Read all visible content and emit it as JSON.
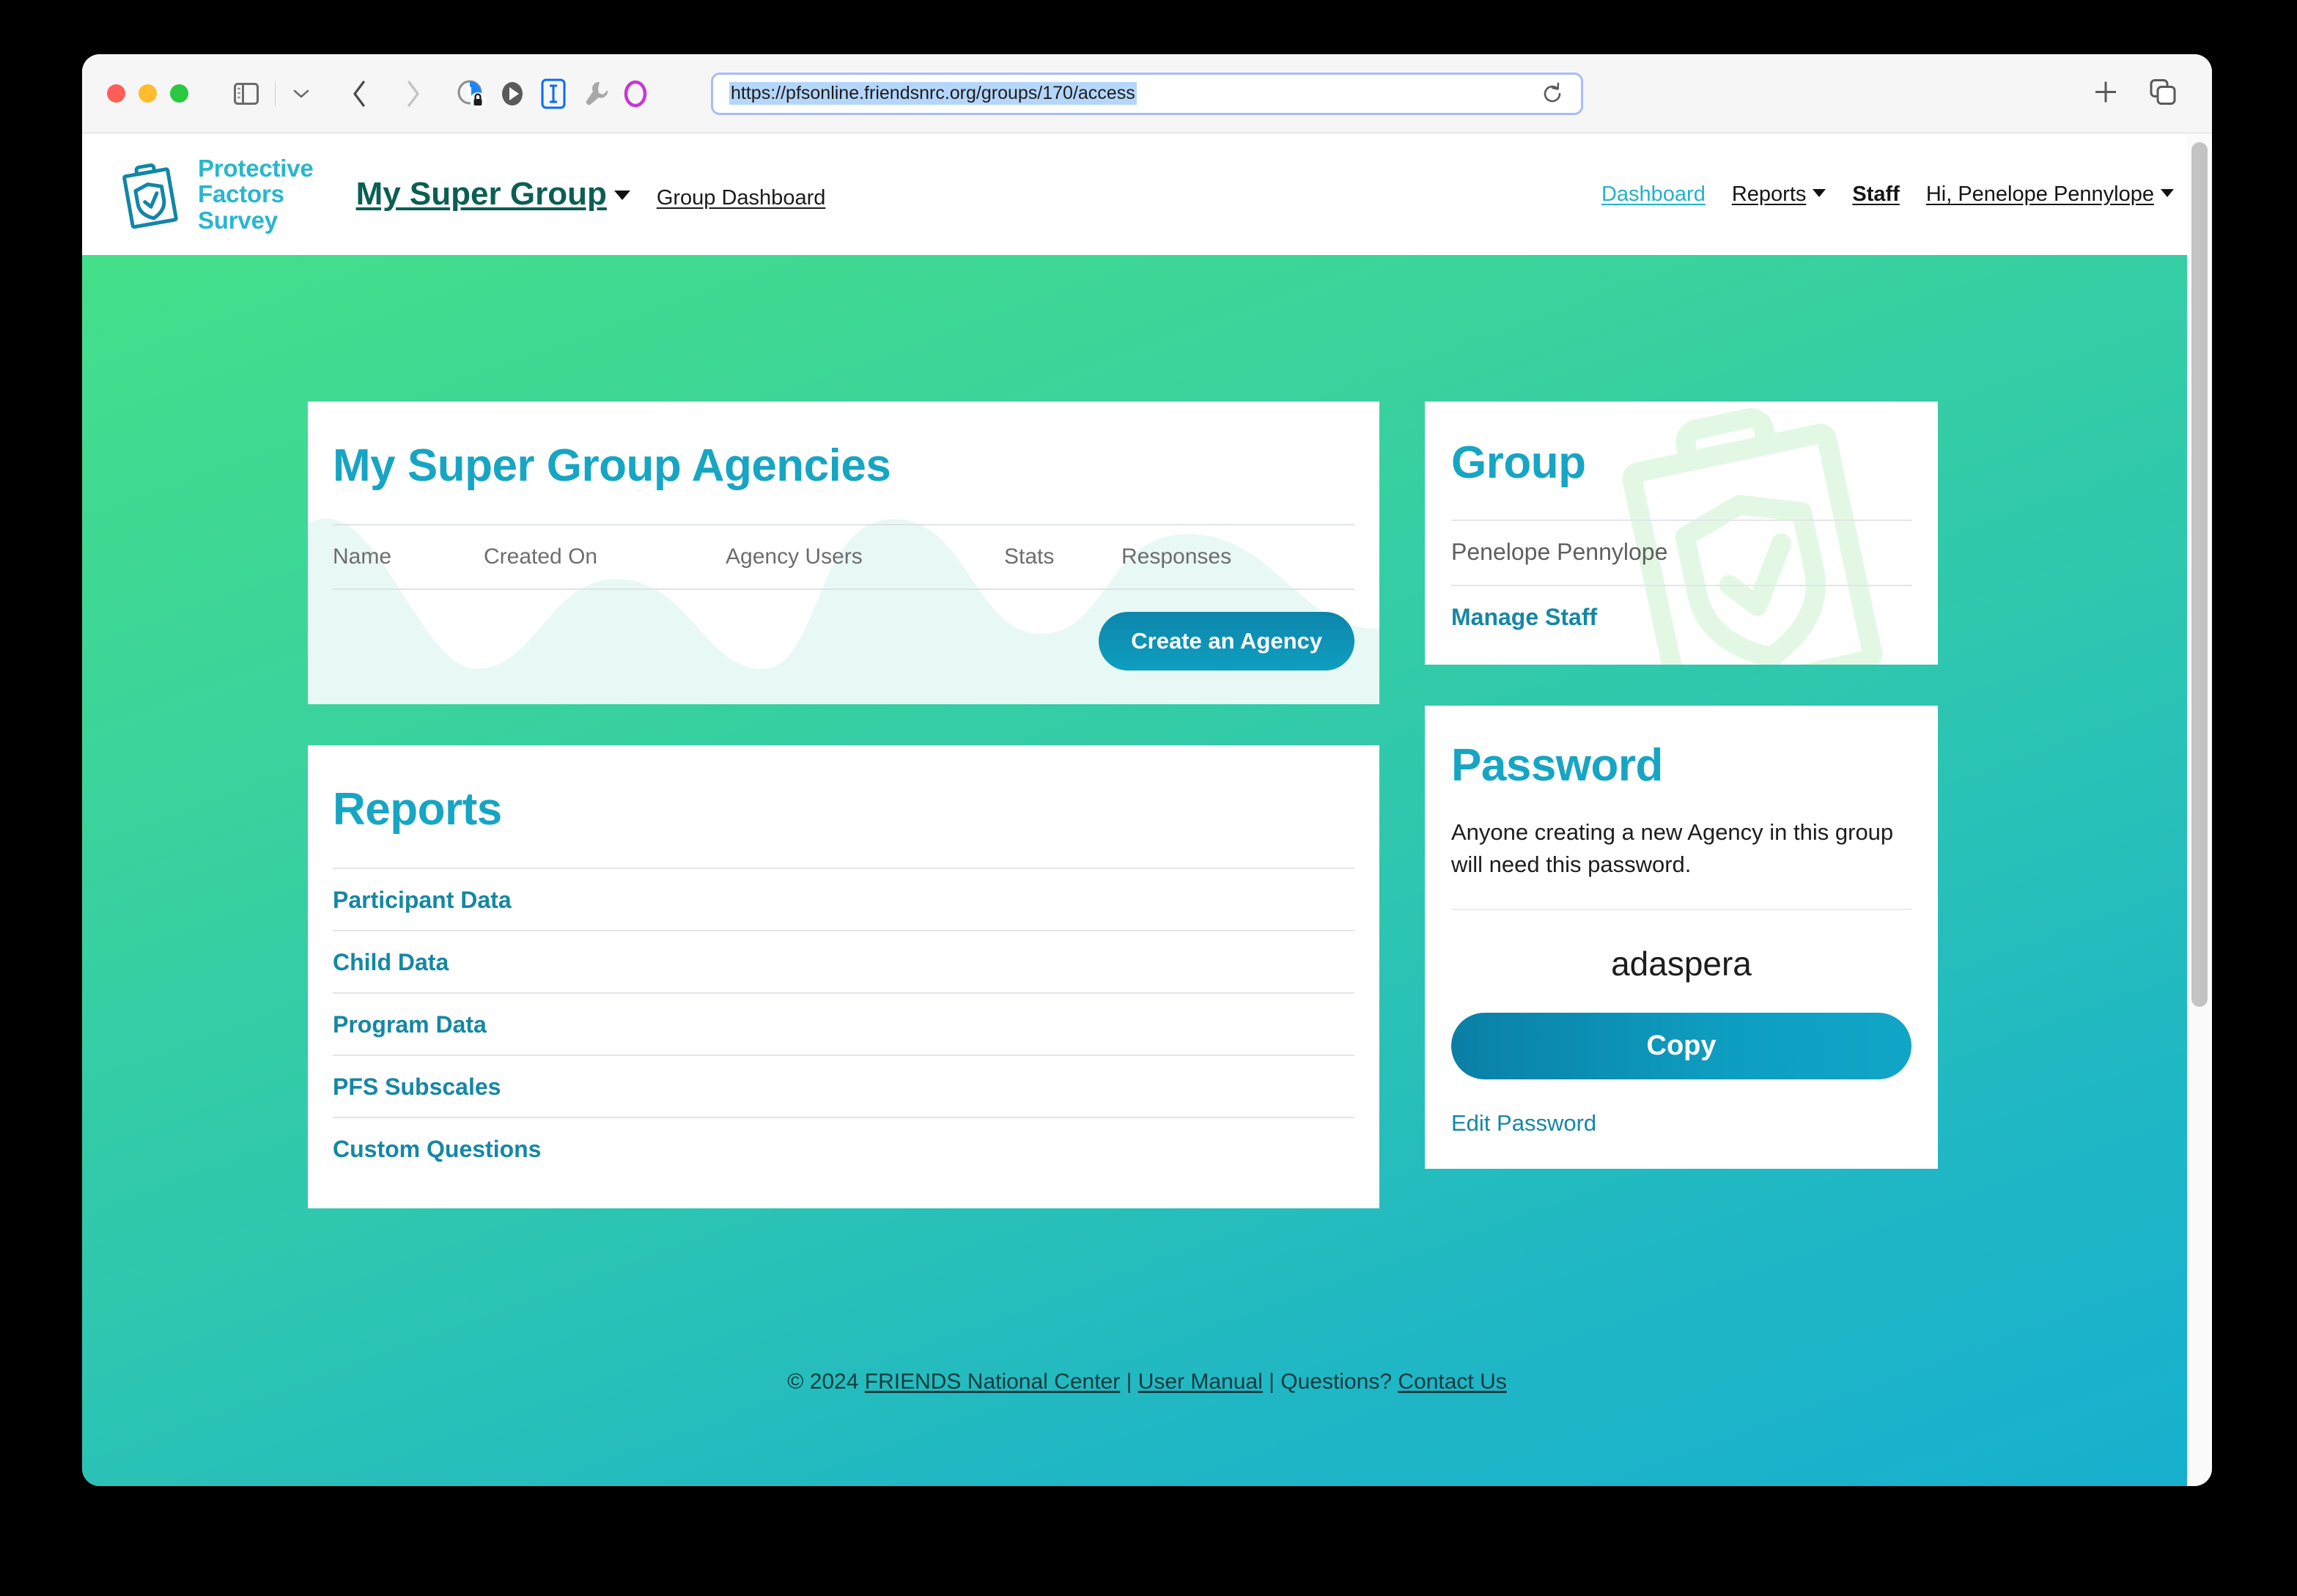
{
  "browser": {
    "url": "https://pfsonline.friendsnrc.org/groups/170/access",
    "url_selected": true,
    "toolbar_icons": [
      "sidebar-toggle-icon",
      "chevron-down-icon",
      "back-arrow-icon",
      "forward-arrow-icon",
      "privacy-lock-icon",
      "play-icon",
      "reader-mode-icon",
      "wrench-icon",
      "ring-icon"
    ],
    "right_icons": [
      "new-tab-plus-icon",
      "tab-overview-icon"
    ],
    "reload_icon": "reload-icon"
  },
  "header": {
    "brand": {
      "logo_icon": "clipboard-shield-check-icon",
      "line1": "Protective",
      "line2": "Factors",
      "line3": "Survey"
    },
    "group_name": "My Super Group",
    "group_dashboard_label": "Group Dashboard",
    "nav": [
      {
        "label": "Dashboard",
        "active": true,
        "has_caret": false,
        "bold": false
      },
      {
        "label": "Reports",
        "active": false,
        "has_caret": true,
        "bold": false
      },
      {
        "label": "Staff",
        "active": false,
        "has_caret": false,
        "bold": true
      },
      {
        "label": "Hi, Penelope Pennylope",
        "active": false,
        "has_caret": true,
        "bold": false
      }
    ]
  },
  "agencies_card": {
    "title": "My Super Group Agencies",
    "columns": [
      "Name",
      "Created On",
      "Agency Users",
      "Stats",
      "Responses"
    ],
    "rows": [],
    "create_button_label": "Create an Agency"
  },
  "reports_card": {
    "title": "Reports",
    "items": [
      "Participant Data",
      "Child Data",
      "Program Data",
      "PFS Subscales",
      "Custom Questions"
    ]
  },
  "group_card": {
    "title": "Group",
    "owner": "Penelope Pennylope",
    "manage_staff_label": "Manage Staff"
  },
  "password_card": {
    "title": "Password",
    "description": "Anyone creating a new Agency in this group will need this password.",
    "value": "adaspera",
    "copy_label": "Copy",
    "edit_label": "Edit Password"
  },
  "footer": {
    "copyright": "© 2024 ",
    "org_link": "FRIENDS National Center",
    "sep1": " | ",
    "manual_link": "User Manual",
    "sep2": " | Questions? ",
    "contact_link": "Contact Us"
  },
  "colors": {
    "brand_teal": "#29b6ce",
    "card_title": "#17a5c4",
    "group_name": "#0b5f52",
    "link_teal": "#1587a4",
    "nav_active": "#22b2c9",
    "button_gradient_start": "#0a7fa6",
    "button_gradient_end": "#10a5c6",
    "bg_gradient_start": "#44df8a",
    "bg_gradient_end": "#17b0ce"
  }
}
